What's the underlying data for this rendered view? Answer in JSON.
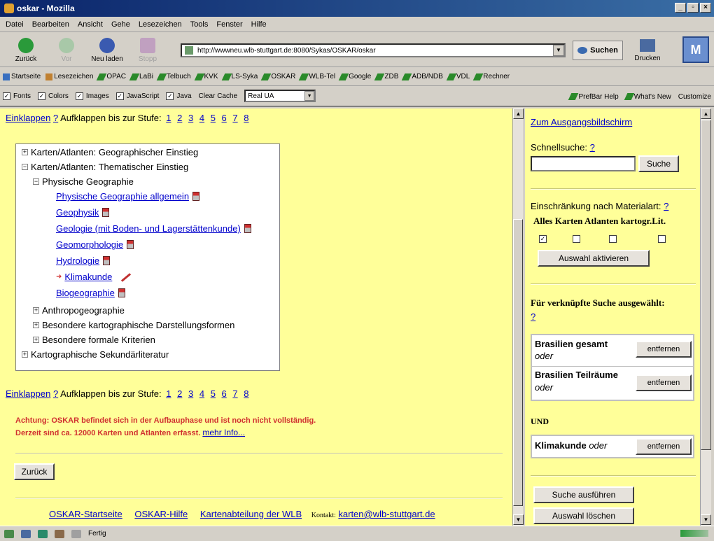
{
  "window": {
    "title": "oskar - Mozilla"
  },
  "menu": [
    "Datei",
    "Bearbeiten",
    "Ansicht",
    "Gehe",
    "Lesezeichen",
    "Tools",
    "Fenster",
    "Hilfe"
  ],
  "nav": {
    "back": "Zurück",
    "forward": "Vor",
    "reload": "Neu laden",
    "stop": "Stopp",
    "url": "http://wwwneu.wlb-stuttgart.de:8080/Sykas/OSKAR/oskar",
    "search": "Suchen",
    "print": "Drucken"
  },
  "bookmarks": [
    "Startseite",
    "Lesezeichen",
    "OPAC",
    "LaBi",
    "Telbuch",
    "KVK",
    "LS-Syka",
    "OSKAR",
    "WLB-Tel",
    "Google",
    "ZDB",
    "ADB/NDB",
    "VDL",
    "Rechner"
  ],
  "prefbar": {
    "fonts": "Fonts",
    "colors": "Colors",
    "images": "Images",
    "javascript": "JavaScript",
    "java": "Java",
    "clear_cache": "Clear Cache",
    "ua": "Real UA",
    "help": "PrefBar Help",
    "whatsnew": "What's New",
    "customize": "Customize"
  },
  "main": {
    "collapse": "Einklappen",
    "help": "?",
    "expand_label": "Aufklappen bis zur Stufe:",
    "levels": [
      "1",
      "2",
      "3",
      "4",
      "5",
      "6",
      "7",
      "8"
    ],
    "tree": {
      "geo": "Karten/Atlanten: Geographischer Einstieg",
      "them": "Karten/Atlanten: Thematischer Einstieg",
      "phys": "Physische Geographie",
      "allg": "Physische Geographie allgemein",
      "geophysik": "Geophysik",
      "geologie": "Geologie (mit Boden- und Lagerstättenkunde)",
      "geomorph": "Geomorphologie",
      "hydro": "Hydrologie",
      "klima": "Klimakunde",
      "biogeo": "Biogeographie",
      "anthro": "Anthropogeographie",
      "kartodar": "Besondere kartographische Darstellungsformen",
      "formal": "Besondere formale Kriterien",
      "sekund": "Kartographische Sekundärliteratur"
    },
    "warning1": "Achtung: OSKAR befindet sich in der Aufbauphase und ist noch nicht vollständig.",
    "warning2": "Derzeit sind ca. 12000 Karten und Atlanten erfasst.",
    "more_info": "mehr Info...",
    "back_button": "Zurück",
    "footer": {
      "start": "OSKAR-Startseite",
      "help": "OSKAR-Hilfe",
      "dept": "Kartenabteilung der WLB",
      "contact_label": "Kontakt:",
      "email": "karten@wlb-stuttgart.de"
    }
  },
  "side": {
    "home": "Zum Ausgangsbildschirm",
    "quick_label": "Schnellsuche:",
    "help": "?",
    "quick_value": "",
    "search_btn": "Suche",
    "restrict_label": "Einschränkung nach Materialart:",
    "types": [
      "Alles",
      "Karten",
      "Atlanten",
      "kartogr.Lit."
    ],
    "type_checked": [
      true,
      false,
      false,
      false
    ],
    "activate_btn": "Auswahl aktivieren",
    "linked_label": "Für verknüpfte Suche ausgewählt:",
    "sel": [
      {
        "label": "Brasilien gesamt",
        "op": "oder",
        "btn": "entfernen"
      },
      {
        "label": "Brasilien Teilräume",
        "op": "oder",
        "btn": "entfernen"
      }
    ],
    "und": "UND",
    "sel2": {
      "label": "Klimakunde",
      "op": "oder",
      "btn": "entfernen"
    },
    "run_btn": "Suche ausführen",
    "clear_btn": "Auswahl löschen"
  },
  "status": {
    "text": "Fertig"
  }
}
